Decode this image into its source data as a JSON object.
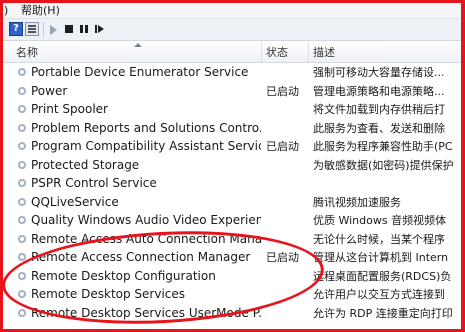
{
  "menu": {
    "view_fragment": ")",
    "help": "帮助(H)"
  },
  "toolbar": {
    "help_glyph": "?"
  },
  "columns": {
    "name": "名称",
    "status": "状态",
    "description": "描述"
  },
  "services": [
    {
      "name": "Portable Device Enumerator Service",
      "status": "",
      "description": "强制可移动大容量存储设..."
    },
    {
      "name": "Power",
      "status": "已启动",
      "description": "管理电源策略和电源策略..."
    },
    {
      "name": "Print Spooler",
      "status": "",
      "description": "将文件加载到内存供稍后打"
    },
    {
      "name": "Problem Reports and Solutions Contro...",
      "status": "",
      "description": "此服务为查看、发送和删除"
    },
    {
      "name": "Program Compatibility Assistant Service",
      "status": "已启动",
      "description": "此服务为程序兼容性助手(PC"
    },
    {
      "name": "Protected Storage",
      "status": "",
      "description": "为敏感数据(如密码)提供保护"
    },
    {
      "name": "PSPR Control Service",
      "status": "",
      "description": ""
    },
    {
      "name": "QQLiveService",
      "status": "",
      "description": "腾讯视频加速服务"
    },
    {
      "name": "Quality Windows Audio Video Experien...",
      "status": "",
      "description": "优质 Windows 音频视频体"
    },
    {
      "name": "Remote Access Auto Connection Mana...",
      "status": "",
      "description": "无论什么时候，当某个程序"
    },
    {
      "name": "Remote Access Connection Manager",
      "status": "已启动",
      "description": "管理从这台计算机到 Intern"
    },
    {
      "name": "Remote Desktop Configuration",
      "status": "",
      "description": "远程桌面配置服务(RDCS)负"
    },
    {
      "name": "Remote Desktop Services",
      "status": "",
      "description": "允许用户以交互方式连接到"
    },
    {
      "name": "Remote Desktop Services UserMode P...",
      "status": "",
      "description": "允许为 RDP 连接重定向打印"
    }
  ]
}
